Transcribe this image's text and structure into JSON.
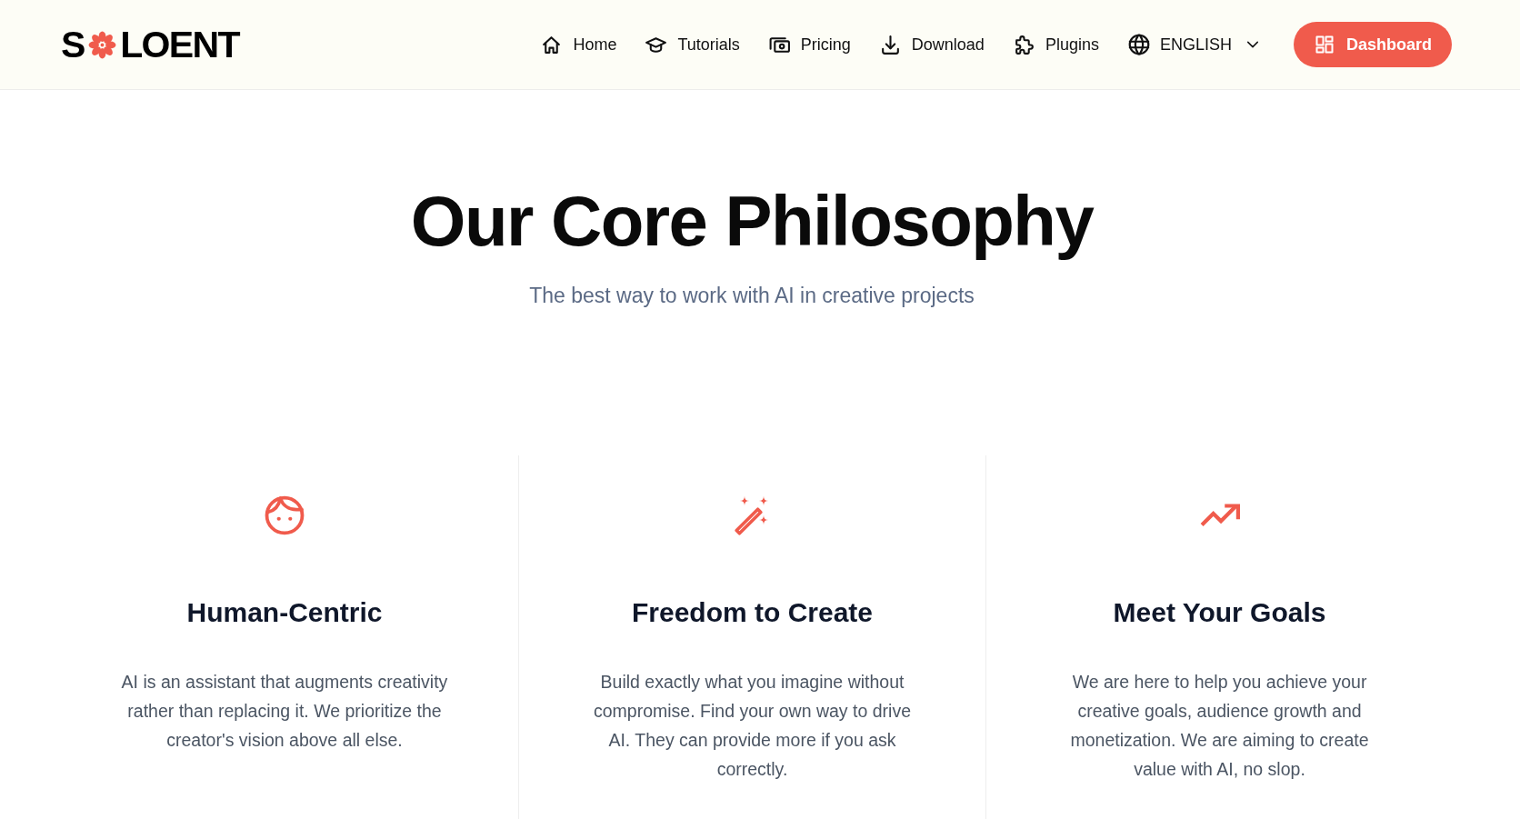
{
  "header": {
    "logo": {
      "lead": "S",
      "tail": "LOENT"
    },
    "nav": [
      {
        "label": "Home"
      },
      {
        "label": "Tutorials"
      },
      {
        "label": "Pricing"
      },
      {
        "label": "Download"
      },
      {
        "label": "Plugins"
      }
    ],
    "language": {
      "label": "ENGLISH",
      "expanded": false
    },
    "cta": {
      "label": "Dashboard"
    }
  },
  "hero": {
    "title": "Our Core Philosophy",
    "subtitle": "The best way to work with AI in creative projects"
  },
  "features": [
    {
      "title": "Human-Centric",
      "body": "AI is an assistant that augments creativity rather than replacing it. We prioritize the creator's vision above all else."
    },
    {
      "title": "Freedom to Create",
      "body": "Build exactly what you imagine without compromise. Find your own way to drive AI. They can provide more if you ask correctly."
    },
    {
      "title": "Meet Your Goals",
      "body": "We are here to help you achieve your creative goals, audience growth and monetization. We are aiming to create value with AI, no slop."
    }
  ]
}
